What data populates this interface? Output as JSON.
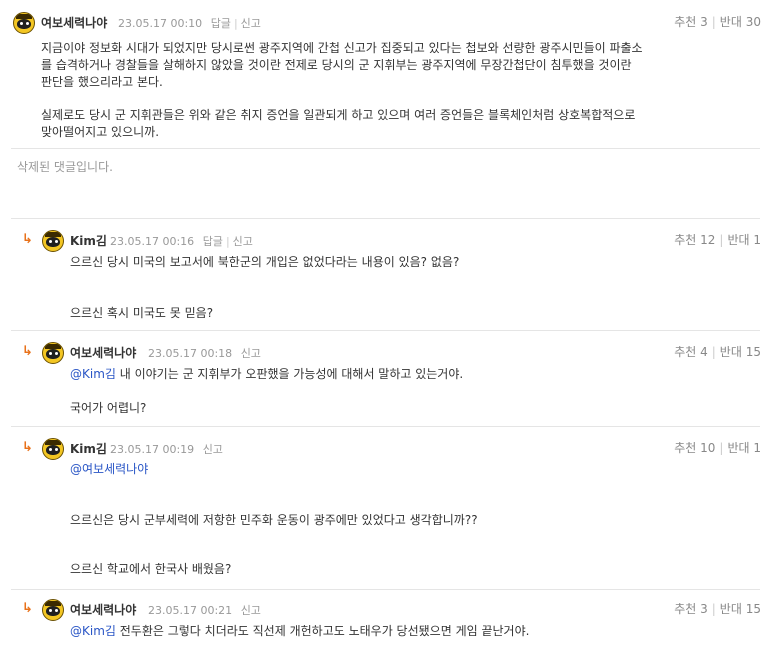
{
  "comments": [
    {
      "author": "여보세력나야",
      "date": "23.05.17 00:10",
      "reply": "답글",
      "report": "신고",
      "up_label": "추천",
      "up": "3",
      "down_label": "반대",
      "down": "30",
      "lines": [
        "지금이야 정보화 시대가 되었지만 당시로썬 광주지역에 간첩 신고가 집중되고 있다는 첩보와 선량한 광주시민들이 파출소",
        "를 습격하거나 경찰들을 살해하지 않았을 것이란 전제로 당시의 군 지휘부는 광주지역에 무장간첩단이 침투했을 것이란",
        "판단을 했으리라고 본다.",
        "실제로도 당시 군 지휘관들은 위와 같은 취지 증언을 일관되게 하고 있으며 여러 증언들은 블록체인처럼 상호복합적으로",
        "맞아떨어지고 있으니까."
      ]
    },
    {
      "deleted": "삭제된 댓글입니다."
    },
    {
      "author": "Kim김",
      "date": "23.05.17 00:16",
      "reply": "답글",
      "report": "신고",
      "up_label": "추천",
      "up": "12",
      "down_label": "반대",
      "down": "1",
      "lines": [
        "으르신 당시 미국의 보고서에 북한군의 개입은 없었다라는 내용이 있음? 없음?",
        "으르신 혹시 미국도 못 믿음?"
      ]
    },
    {
      "author": "여보세력나야",
      "date": "23.05.17 00:18",
      "report": "신고",
      "up_label": "추천",
      "up": "4",
      "down_label": "반대",
      "down": "15",
      "mention": "@Kim김",
      "lines": [
        " 내 이야기는 군 지휘부가 오판했을 가능성에 대해서 말하고 있는거야.",
        "국어가 어렵니?"
      ]
    },
    {
      "author": "Kim김",
      "date": "23.05.17 00:19",
      "report": "신고",
      "up_label": "추천",
      "up": "10",
      "down_label": "반대",
      "down": "1",
      "mention": "@여보세력나야",
      "lines": [
        "으르신은 당시 군부세력에 저항한 민주화 운동이 광주에만 있었다고 생각합니까??",
        "으르신 학교에서 한국사 배웠음?"
      ]
    },
    {
      "author": "여보세력나야",
      "date": "23.05.17 00:21",
      "report": "신고",
      "up_label": "추천",
      "up": "3",
      "down_label": "반대",
      "down": "15",
      "mention": "@Kim김",
      "lines": [
        " 전두환은 그렇다 치더라도 직선제 개헌하고도 노태우가 당선됐으면 게임 끝난거야."
      ]
    }
  ]
}
